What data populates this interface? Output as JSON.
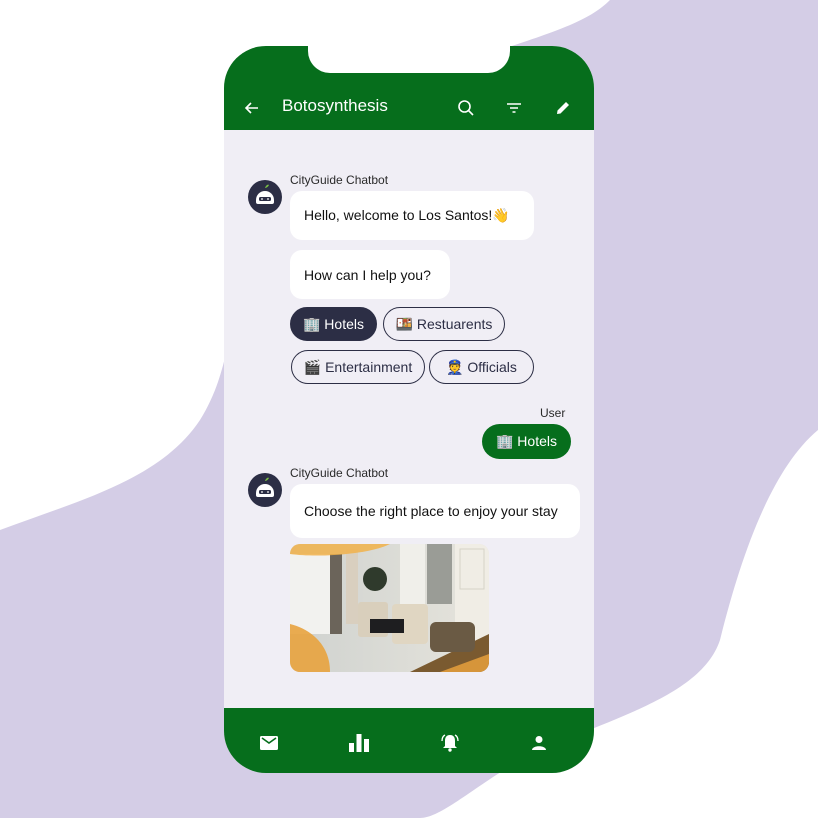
{
  "colors": {
    "brand_green": "#066e1c",
    "chip_dark": "#2c2e45",
    "chat_bg": "#f0eef5",
    "blob": "#d4cde6"
  },
  "header": {
    "title": "Botosynthesis",
    "icons": [
      "arrow-back-icon",
      "search-icon",
      "filter-icon",
      "edit-pencil-icon"
    ]
  },
  "chat": {
    "bot_name": "CityGuide Chatbot",
    "message1": "Hello, welcome to Los Santos!👋",
    "message2": "How can I help you?",
    "chips": [
      {
        "label": "🏢 Hotels",
        "selected": true
      },
      {
        "label": "🍱 Restuarents",
        "selected": false
      },
      {
        "label": "🎬 Entertainment",
        "selected": false
      },
      {
        "label": "👮 Officials",
        "selected": false
      }
    ],
    "user_name": "User",
    "user_message": "🏢 Hotels",
    "bot_name_2": "CityGuide Chatbot",
    "message3": "Choose the right place to enjoy your stay",
    "image_alt": "hotel-lounge-photo"
  },
  "bottom_nav": {
    "items": [
      "mail-icon",
      "bar-chart-icon",
      "bell-ringing-icon",
      "person-icon"
    ]
  }
}
